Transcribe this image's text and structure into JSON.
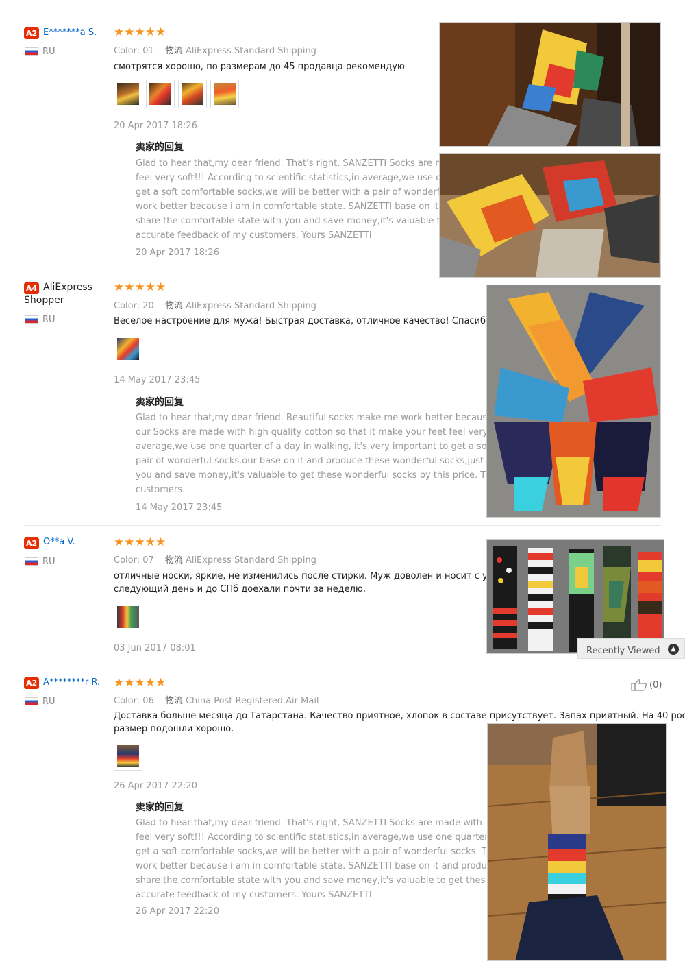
{
  "reviews": [
    {
      "badge": "A2",
      "user": "E*******a S.",
      "country": "RU",
      "stars": "★★★★★",
      "color_label": "Color:",
      "color_value": "01",
      "shipping_prefix": "物流",
      "shipping": "AliExpress Standard Shipping",
      "text_lines": [
        "смотрятся хорошо, по размерам до 45 продавца рекомендую"
      ],
      "date": "20 Apr 2017 18:26",
      "reply_title": "卖家的回复",
      "reply_lines": [
        "Glad to hear that,my dear friend. That's right, SANZETTI Socks are made with high quality cotton so that it make your",
        "feel very soft!!! According to scientific statistics,in average,we use one quarter of a day in walking, it's very important to",
        "get a soft comfortable socks,we will be better with a pair of wonderful socks. To make wonderful socks and make me",
        "work better because i am in comfortable state. SANZETTI base on it and produce these wonderful socks,just want to",
        "share the comfortable state with you and save money,it's valuable to get these wonderful socks by this price. Thank you for",
        "accurate feedback of my customers. Yours SANZETTI"
      ],
      "reply_date": "20 Apr 2017 18:26"
    },
    {
      "badge": "A4",
      "user": "AliExpress",
      "user_line2": "Shopper",
      "country": "RU",
      "stars": "★★★★★",
      "color_label": "Color:",
      "color_value": "20",
      "shipping_prefix": "物流",
      "shipping": "AliExpress Standard Shipping",
      "text_lines": [
        "Веселое настроение для мужа! Быстрая доставка, отличное качество! Спасибо Продавцу!"
      ],
      "date": "14 May 2017 23:45",
      "reply_title": "卖家的回复",
      "reply_lines": [
        "Glad to hear that,my dear friend. Beautiful socks make me work better because i am in a good mood every day. And",
        "our Socks are made with high quality cotton so that it make your feet feel very soft!!! According to scientific statistics,in",
        "average,we use one quarter of a day in walking, it's very important to get a soft comfortable socks,we will be better with a",
        "pair of wonderful socks.our base on it and produce these wonderful socks,just want to share the comfortable state with",
        "you and save money,it's valuable to get these wonderful socks by this price. Thank you for accurate feedback of my",
        "customers."
      ],
      "reply_date": "14 May 2017 23:45"
    },
    {
      "badge": "A2",
      "user": "O**a V.",
      "country": "RU",
      "stars": "★★★★★",
      "color_label": "Color:",
      "color_value": "07",
      "shipping_prefix": "物流",
      "shipping": "AliExpress Standard Shipping",
      "text_lines": [
        "отличные носки, яркие, не изменились после стирки. Муж доволен и носит с удовольствием. Заказ оформила в один",
        "следующий день и до СПб доехали почти за неделю."
      ],
      "date": "03 Jun 2017 08:01"
    },
    {
      "badge": "A2",
      "user": "A********r R.",
      "country": "RU",
      "stars": "★★★★★",
      "color_label": "Color:",
      "color_value": "06",
      "shipping_prefix": "物流",
      "shipping": "China Post Registered Air Mail",
      "text_lines": [
        "Доставка больше месяца до Татарстана. Качество приятное, хлопок в составе присутствует. Запах приятный. На 40 рос.",
        "размер подошли хорошо."
      ],
      "date": "26 Apr 2017 22:20",
      "helpful_count": "(0)",
      "reply_title": "卖家的回复",
      "reply_lines": [
        "Glad to hear that,my dear friend. That's right, SANZETTI  Socks are made with high quality cotton so that it make your",
        "feel very soft!!! According to scientific statistics,in average,we use one quarter of a day in walking, it's very important to",
        "get a soft comfortable socks,we will be better with a pair of wonderful socks. To make wonderful socks and make me",
        "work better because i am in comfortable state. SANZETTI  base on it and produce these wonderful socks,just want to",
        "share the comfortable state with you and save money,it's valuable to get these wonderful socks by this price. Thank you for",
        "accurate feedback of my customers. Yours SANZETTI"
      ],
      "reply_date": "26 Apr 2017 22:20"
    }
  ],
  "recently_viewed": "Recently Viewed",
  "colors": {
    "badge": "#e62e04",
    "star": "#f7931e",
    "username_link": "#0064c8",
    "muted_text": "#999999"
  },
  "icons": [
    "flag-ru-icon",
    "thumbs-up-icon",
    "chevron-up-icon"
  ]
}
